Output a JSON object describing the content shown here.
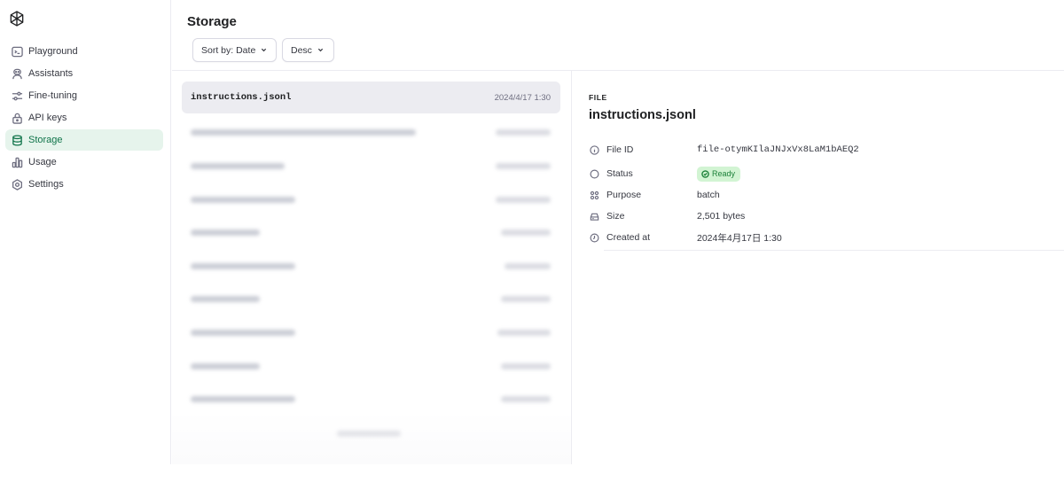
{
  "sidebar": {
    "logo_icon": "openai-logo-icon",
    "items": [
      {
        "label": "Playground",
        "icon": "terminal-icon"
      },
      {
        "label": "Assistants",
        "icon": "robot-icon"
      },
      {
        "label": "Fine-tuning",
        "icon": "sliders-icon"
      },
      {
        "label": "API keys",
        "icon": "lock-icon"
      },
      {
        "label": "Storage",
        "icon": "database-icon",
        "active": true
      },
      {
        "label": "Usage",
        "icon": "bar-chart-icon"
      },
      {
        "label": "Settings",
        "icon": "gear-icon"
      }
    ]
  },
  "header": {
    "title": "Storage",
    "sort_label": "Sort by: Date",
    "order_label": "Desc"
  },
  "files": {
    "selected": {
      "name": "instructions.jsonl",
      "date": "2024/4/17 1:30"
    }
  },
  "detail": {
    "kicker": "FILE",
    "title": "instructions.jsonl",
    "props": {
      "file_id_label": "File ID",
      "file_id_value": "file-otymKIlaJNJxVx8LaM1bAEQ2",
      "status_label": "Status",
      "status_value": "Ready",
      "purpose_label": "Purpose",
      "purpose_value": "batch",
      "size_label": "Size",
      "size_value": "2,501 bytes",
      "created_label": "Created at",
      "created_value": "2024年4月17日 1:30"
    }
  },
  "colors": {
    "active_bg": "#e6f4ec",
    "active_text": "#10744a",
    "badge_bg": "#d2f4d3",
    "badge_text": "#1a7f37"
  }
}
